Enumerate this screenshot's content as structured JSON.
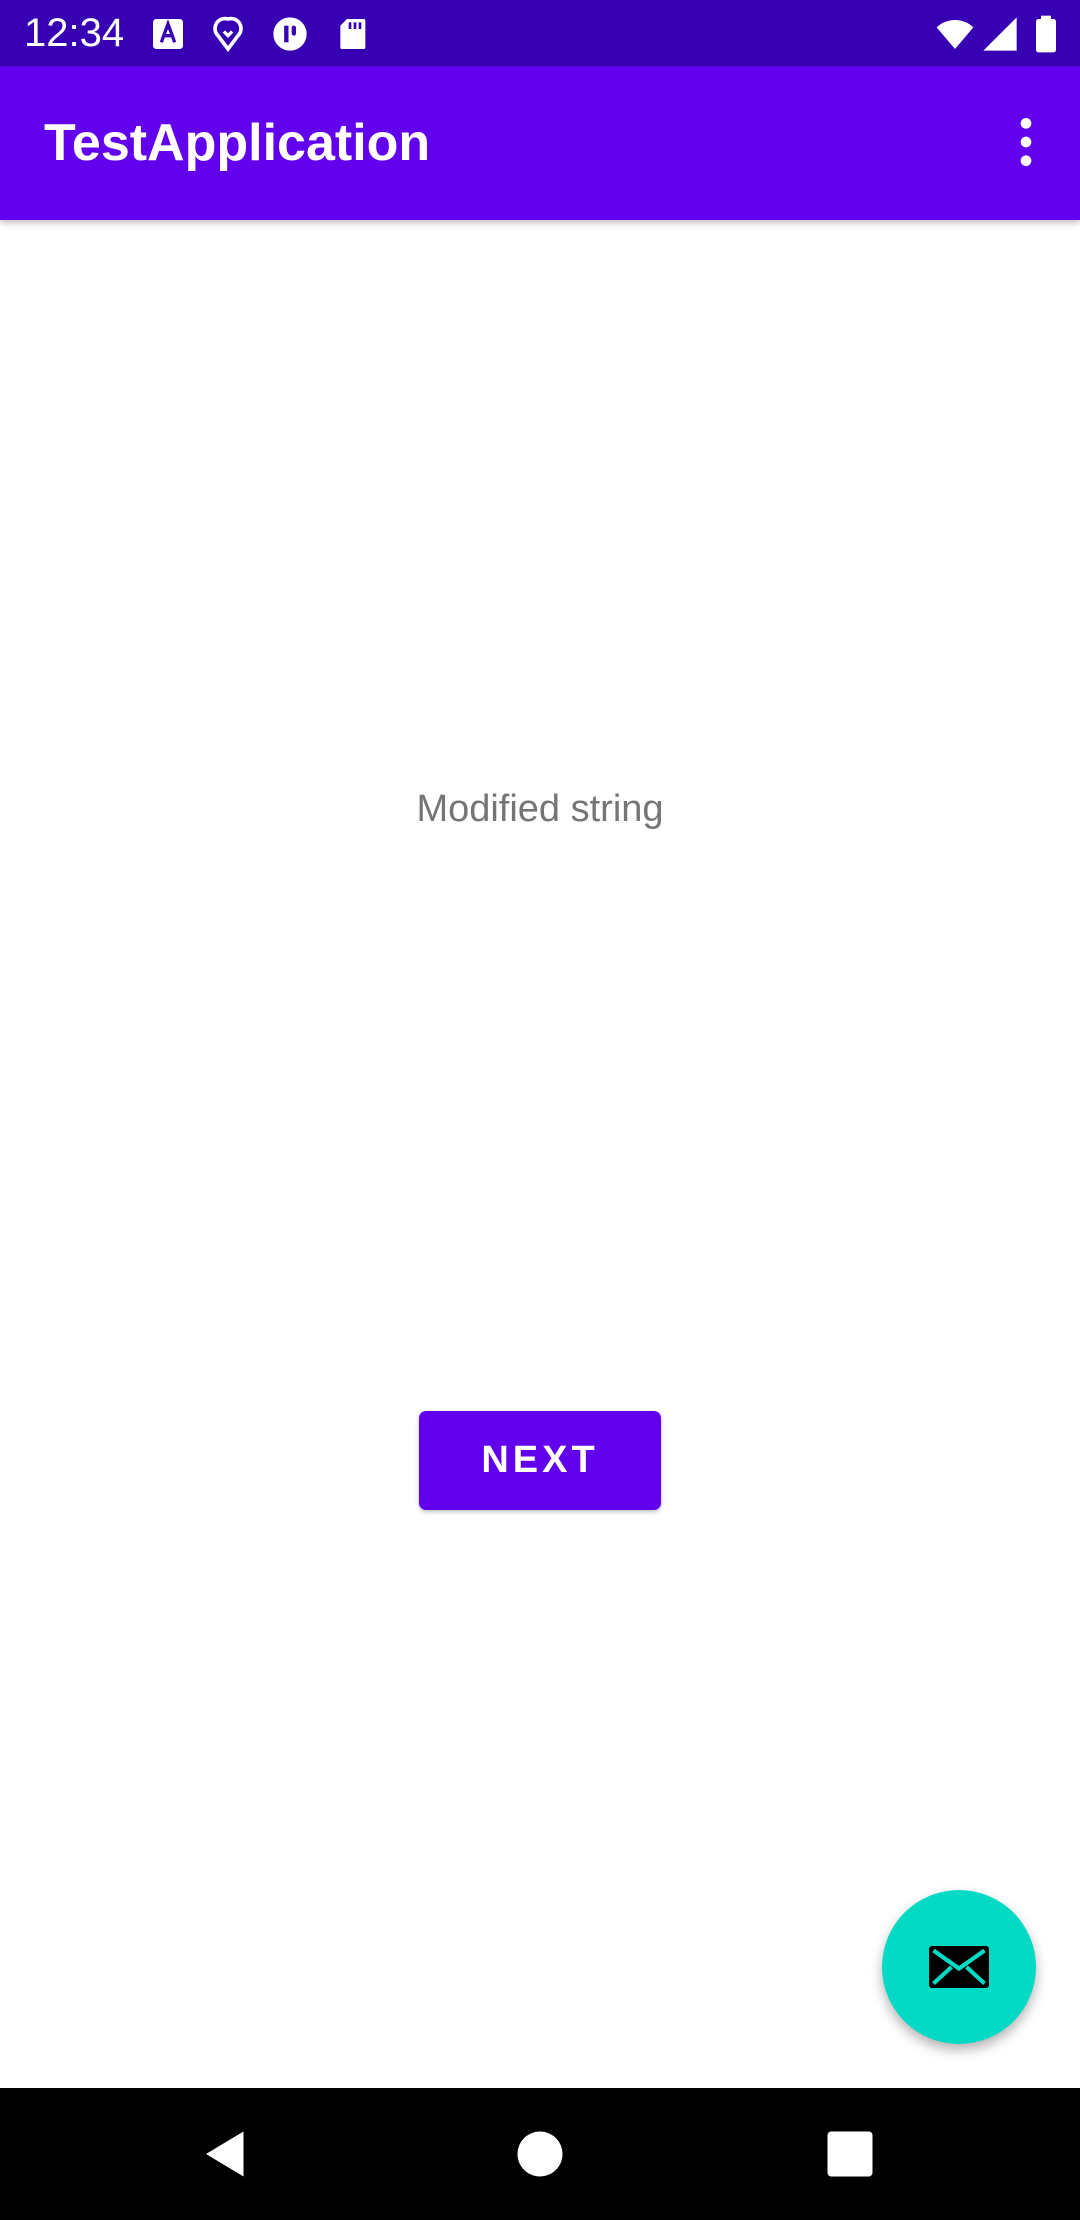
{
  "status_bar": {
    "time": "12:34",
    "icons": [
      "font-a-icon",
      "location-icon",
      "app-badge-icon",
      "sd-card-icon",
      "wifi-icon",
      "cellular-signal-icon",
      "battery-icon"
    ],
    "background_color": "#3700b3"
  },
  "app_bar": {
    "title": "TestApplication",
    "overflow_icon": "more-vert-icon",
    "background_color": "#6200ee"
  },
  "content": {
    "center_text": "Modified string",
    "next_button_label": "NEXT"
  },
  "fab": {
    "icon": "email-icon",
    "background_color": "#03dac5"
  },
  "nav_bar": {
    "icons": [
      "back-icon",
      "home-icon",
      "recents-icon"
    ]
  }
}
